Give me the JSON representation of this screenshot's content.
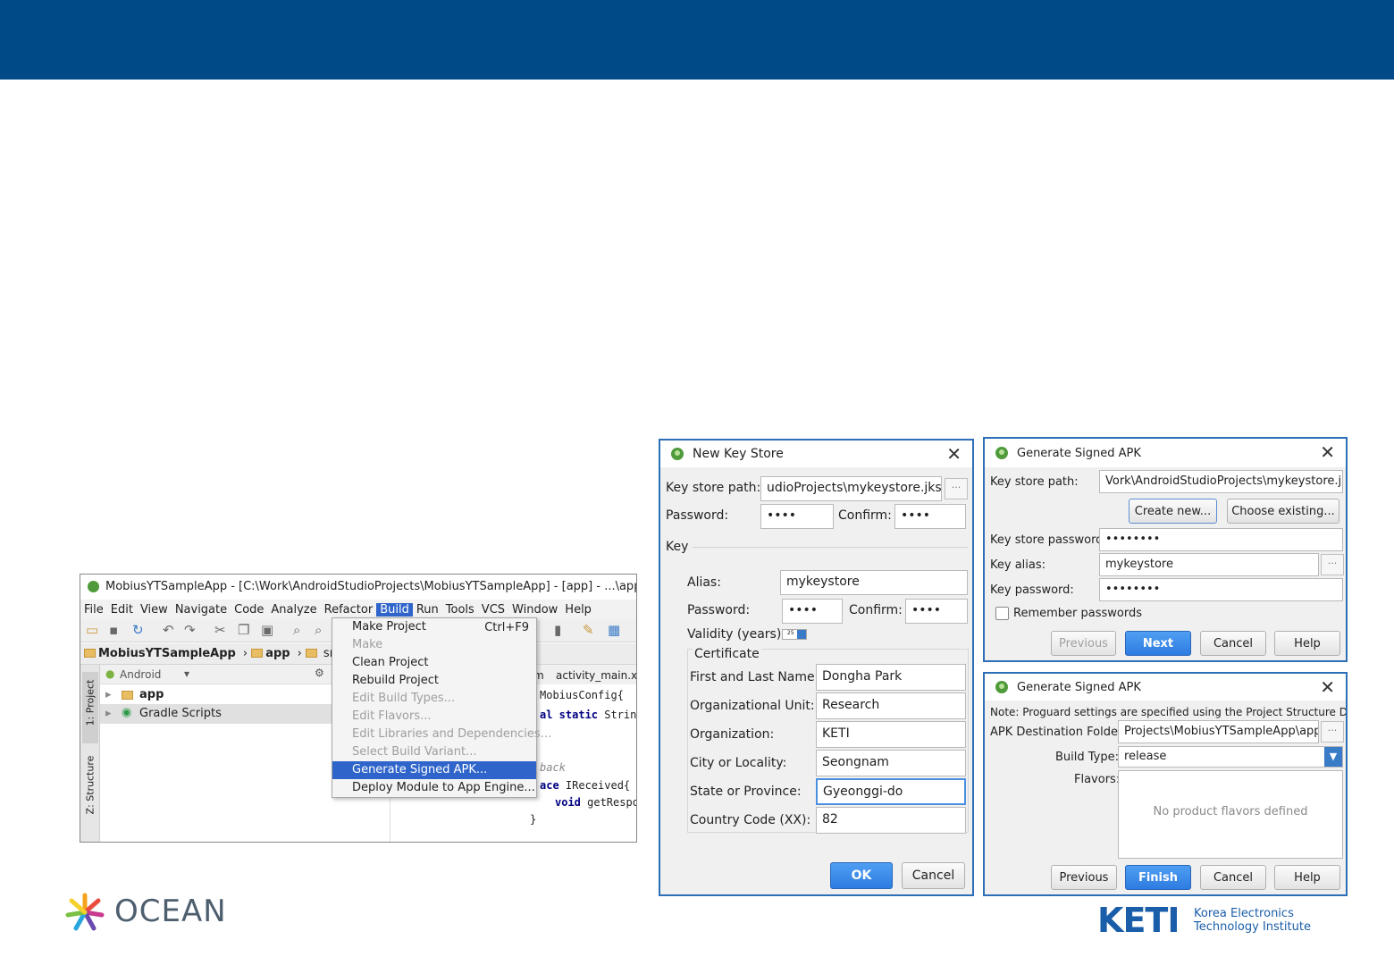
{
  "ide": {
    "title": "MobiusYTSampleApp - [C:\\Work\\AndroidStudioProjects\\MobiusYTSampleApp] - [app] - ...\\app\\src",
    "menus": [
      "File",
      "Edit",
      "View",
      "Navigate",
      "Code",
      "Analyze",
      "Refactor",
      "Build",
      "Run",
      "Tools",
      "VCS",
      "Window",
      "Help"
    ],
    "breadcrumb": [
      "MobiusYTSampleApp",
      "app",
      "src"
    ],
    "editor_tabs": [
      "mobiusytsampleapp",
      "activity_main.xm"
    ],
    "project_view": "Android",
    "tree": [
      "app",
      "Gradle Scripts"
    ],
    "side_tabs": [
      "1: Project",
      "Z: Structure"
    ],
    "build_menu": {
      "make_project": "Make Project",
      "make_project_shortcut": "Ctrl+F9",
      "make": "Make",
      "clean": "Clean Project",
      "rebuild": "Rebuild Project",
      "edit_build_types": "Edit Build Types...",
      "edit_flavors": "Edit Flavors...",
      "edit_libraries": "Edit Libraries and Dependencies...",
      "select_variant": "Select Build Variant...",
      "generate_signed": "Generate Signed APK...",
      "deploy": "Deploy Module to App Engine..."
    },
    "code": {
      "line1": "MobiusConfig{",
      "line2_kw": "al static",
      "line2_rest": " String",
      "line3": "back",
      "line4_kw": "ace",
      "line4_rest": " IReceived{",
      "line5_kw": "void",
      "line5_rest": " getResponseBody(String",
      "line6": "}"
    }
  },
  "new_key_store": {
    "title": "New Key Store",
    "key_store_path_label": "Key store path:",
    "key_store_path": "udioProjects\\mykeystore.jks",
    "password_label": "Password:",
    "password": "••••",
    "confirm_label": "Confirm:",
    "confirm": "••••",
    "key_section": "Key",
    "alias_label": "Alias:",
    "alias": "mykeystore",
    "key_password_label": "Password:",
    "key_password": "••••",
    "key_confirm_label": "Confirm:",
    "key_confirm": "••••",
    "validity_label": "Validity (years):",
    "validity": "25",
    "certificate_section": "Certificate",
    "first_last_label": "First and Last Name:",
    "first_last": "Dongha Park",
    "org_unit_label": "Organizational Unit:",
    "org_unit": "Research",
    "org_label": "Organization:",
    "org": "KETI",
    "city_label": "City or Locality:",
    "city": "Seongnam",
    "state_label": "State or Province:",
    "state": "Gyeonggi-do",
    "country_label": "Country Code (XX):",
    "country": "82",
    "ok": "OK",
    "cancel": "Cancel"
  },
  "gen_apk_1": {
    "title": "Generate Signed APK",
    "key_store_path_label": "Key store path:",
    "key_store_path": "Vork\\AndroidStudioProjects\\mykeystore.jks",
    "create_new": "Create new...",
    "choose_existing": "Choose existing...",
    "ks_password_label": "Key store password:",
    "ks_password": "••••••••",
    "key_alias_label": "Key alias:",
    "key_alias": "mykeystore",
    "key_password_label": "Key password:",
    "key_password": "••••••••",
    "remember": "Remember passwords",
    "previous": "Previous",
    "next": "Next",
    "cancel": "Cancel",
    "help": "Help"
  },
  "gen_apk_2": {
    "title": "Generate Signed APK",
    "note": "Note: Proguard settings are specified using the Project Structure Dialog",
    "dest_label": "APK Destination Folder:",
    "dest": "Projects\\MobiusYTSampleApp\\app",
    "build_type_label": "Build Type:",
    "build_type": "release",
    "flavors_label": "Flavors:",
    "no_flavors": "No product flavors defined",
    "previous": "Previous",
    "finish": "Finish",
    "cancel": "Cancel",
    "help": "Help"
  },
  "logos": {
    "ocean": "OCEAN",
    "keti": "KETI",
    "keti_line1": "Korea Electronics",
    "keti_line2": "Technology Institute"
  },
  "colors": {
    "header": "#004a87",
    "accent": "#2f65ca",
    "keti": "#1a5da8"
  }
}
